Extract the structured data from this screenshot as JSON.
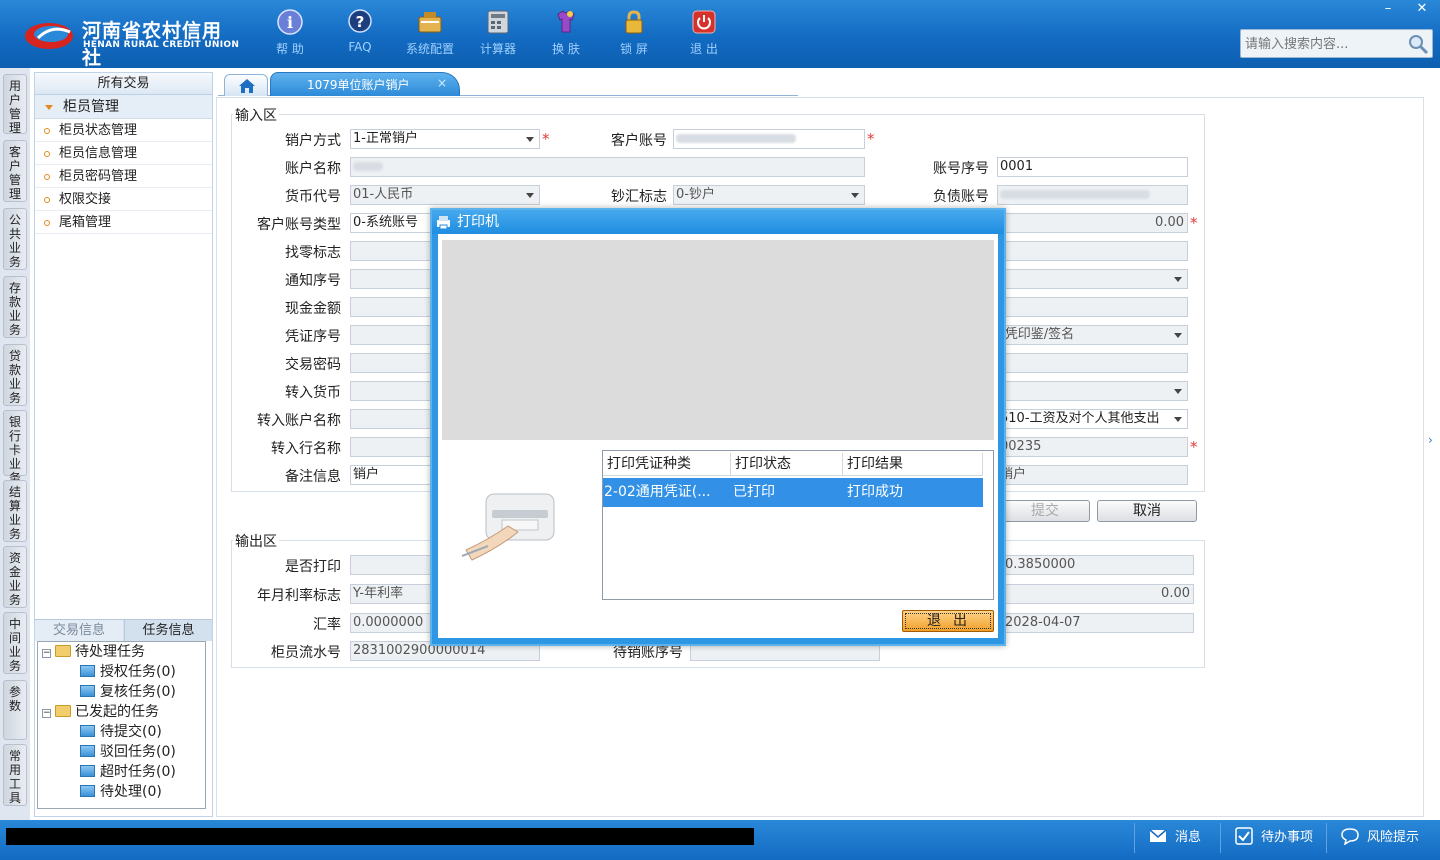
{
  "app": {
    "logo_cn": "河南省农村信用社",
    "logo_en": "HENAN RURAL CREDIT UNION"
  },
  "toolbar": [
    {
      "label": "帮 助",
      "icon": "help-icon"
    },
    {
      "label": "FAQ",
      "icon": "faq-icon"
    },
    {
      "label": "系统配置",
      "icon": "settings-icon"
    },
    {
      "label": "计算器",
      "icon": "calculator-icon"
    },
    {
      "label": "换 肤",
      "icon": "skin-icon"
    },
    {
      "label": "锁 屏",
      "icon": "lock-icon"
    },
    {
      "label": "退 出",
      "icon": "power-icon"
    }
  ],
  "window": {
    "min": "–",
    "close": "✕"
  },
  "search": {
    "placeholder": "请输入搜索内容..."
  },
  "left_strip": [
    "用户管理",
    "客户管理",
    "公共业务",
    "存款业务",
    "贷款业务",
    "银行卡业务",
    "结算业务",
    "资金业务",
    "中间业务",
    "参数",
    "常用工具"
  ],
  "left_panel": {
    "title": "所有交易",
    "group": "柜员管理",
    "items": [
      "柜员状态管理",
      "柜员信息管理",
      "柜员密码管理",
      "权限交接",
      "尾箱管理"
    ],
    "tabs": [
      "交易信息",
      "任务信息"
    ],
    "tree": {
      "pending": "待处理任务",
      "pending_children": [
        "授权任务(0)",
        "复核任务(0)"
      ],
      "initiated": "已发起的任务",
      "initiated_children": [
        "待提交(0)",
        "驳回任务(0)",
        "超时任务(0)",
        "待处理(0)"
      ]
    }
  },
  "tabs": {
    "active": "1079单位账户销户",
    "close": "×"
  },
  "input_section": {
    "legend": "输入区",
    "labels": {
      "close_method": "销户方式",
      "customer_account": "客户账号",
      "account_name": "账户名称",
      "account_seq": "账号序号",
      "currency_code": "货币代号",
      "cash_flag": "钞汇标志",
      "liability_account": "负债账号",
      "account_type": "客户账号类型",
      "change_flag": "找零标志",
      "notice_no": "通知序号",
      "cash_amount": "现金金额",
      "voucher_no": "凭证序号",
      "tx_password": "交易密码",
      "in_currency": "转入货币",
      "in_account_name": "转入账户名称",
      "in_bank_name": "转入行名称",
      "remark": "备注信息"
    },
    "values": {
      "close_method": "1-正常销户",
      "account_seq": "0001",
      "currency_code": "01-人民币",
      "cash_flag": "0-钞户",
      "account_type": "0-系统账号",
      "amount": "0.00",
      "verify_method": "-凭印鉴/签名",
      "purpose": "510-工资及对个人其他支出",
      "account_tail": "00235",
      "remark": "销户",
      "remark2": "销户"
    },
    "buttons": {
      "submit": "提交",
      "cancel": "取消"
    }
  },
  "output_section": {
    "legend": "输出区",
    "labels": {
      "printed": "是否打印",
      "rate_flag": "年月利率标志",
      "exchange_rate": "汇率",
      "teller_serial": "柜员流水号",
      "pending_seq": "待销账序号"
    },
    "values": {
      "rate_flag": "Y-年利率",
      "exchange_rate": "0.0000000",
      "teller_serial": "2831002900000014",
      "rate": "0.3850000",
      "interest": "0.00",
      "date": "2028-04-07"
    }
  },
  "dialog": {
    "title": "打印机",
    "columns": [
      "打印凭证种类",
      "打印状态",
      "打印结果"
    ],
    "row": [
      "2-02通用凭证(...",
      "已打印",
      "打印成功"
    ],
    "exit": "退出"
  },
  "statusbar": [
    {
      "label": "消息",
      "icon": "mail-icon"
    },
    {
      "label": "待办事项",
      "icon": "checkbox-icon"
    },
    {
      "label": "风险提示",
      "icon": "chat-icon"
    }
  ],
  "colors": {
    "header": "#136bc2",
    "accent": "#2d97e3",
    "required": "#e23b3b",
    "selected_row": "#3291e6"
  }
}
